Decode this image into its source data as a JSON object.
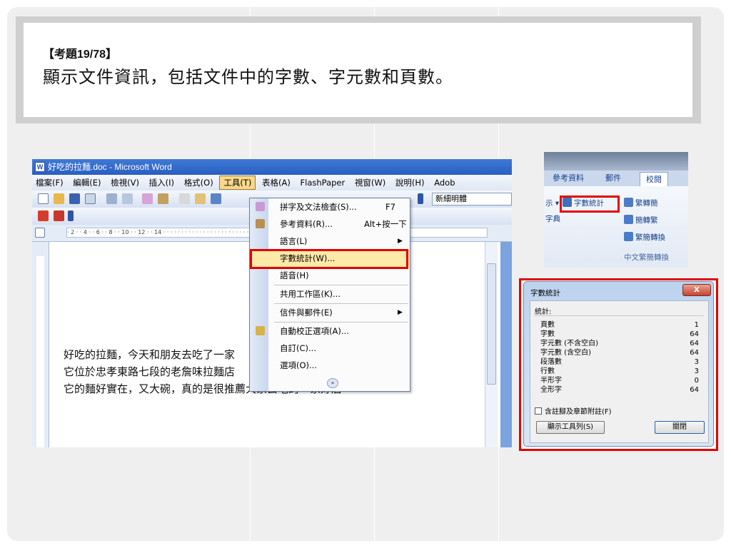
{
  "question": {
    "number": "【考題19/78】",
    "text": "顯示文件資訊，包括文件中的字數、字元數和頁數。"
  },
  "word_window": {
    "title": "好吃的拉麵.doc - Microsoft Word",
    "menubar": [
      "檔案(F)",
      "編輯(E)",
      "檢視(V)",
      "插入(I)",
      "格式(O)",
      "工具(T)",
      "表格(A)",
      "FlashPaper",
      "視窗(W)",
      "說明(H)",
      "Adob"
    ],
    "font_name": "新細明體",
    "ruler_text": "· 2 · · 4 · · 6 · · 8 · · 10 · · 12 · · 14 · · · · · · · · · · · · · · · · · · · · · · · · · · 30 · · 32 · · 34",
    "document_lines": [
      "好吃的拉麵，今天和朋友去吃了一家",
      "它位於忠孝東路七段的老詹味拉麵店",
      "它的麵好實在，又大碗，真的是很推薦大家去吃的一家好店"
    ]
  },
  "tools_menu": {
    "items": [
      {
        "label": "拼字及文法檢查(S)...",
        "shortcut": "F7"
      },
      {
        "label": "參考資料(R)...",
        "shortcut": "Alt+按一下"
      },
      {
        "label": "語言(L)",
        "shortcut": ""
      },
      {
        "label": "字數統計(W)...",
        "shortcut": ""
      },
      {
        "label": "語音(H)",
        "shortcut": ""
      },
      {
        "label": "共用工作區(K)...",
        "shortcut": ""
      },
      {
        "label": "信件與郵件(E)",
        "shortcut": ""
      },
      {
        "label": "自動校正選項(A)...",
        "shortcut": ""
      },
      {
        "label": "自訂(C)...",
        "shortcut": ""
      },
      {
        "label": "選項(O)...",
        "shortcut": ""
      }
    ],
    "expand_icon": "chevron-double-down-icon"
  },
  "ribbon": {
    "tabs": [
      "參考資料",
      "郵件",
      "校閱"
    ],
    "left_fragment_1": "示 ▾",
    "left_fragment_2": "字典",
    "word_count_label": "字數統計",
    "convert_items": [
      "繁轉簡",
      "簡轉繁",
      "繁簡轉換"
    ],
    "group_label": "中文繁簡轉換"
  },
  "word_count_dialog": {
    "title": "字數統計",
    "close_label": "X",
    "stats_header": "統計:",
    "stats": [
      {
        "label": "頁數",
        "value": "1"
      },
      {
        "label": "字數",
        "value": "64"
      },
      {
        "label": "字元數 (不含空白)",
        "value": "64"
      },
      {
        "label": "字元數 (含空白)",
        "value": "64"
      },
      {
        "label": "段落數",
        "value": "3"
      },
      {
        "label": "行數",
        "value": "3"
      },
      {
        "label": "半形字",
        "value": "0"
      },
      {
        "label": "全形字",
        "value": "64"
      }
    ],
    "checkbox_label": "含註腳及章節附註(F)",
    "show_toolbar_button": "顯示工具列(S)",
    "close_button": "關閉"
  },
  "colors": {
    "highlight_red": "#e30000",
    "menu_hover": "#fde9a8",
    "title_bar": "#2a5ec2"
  }
}
